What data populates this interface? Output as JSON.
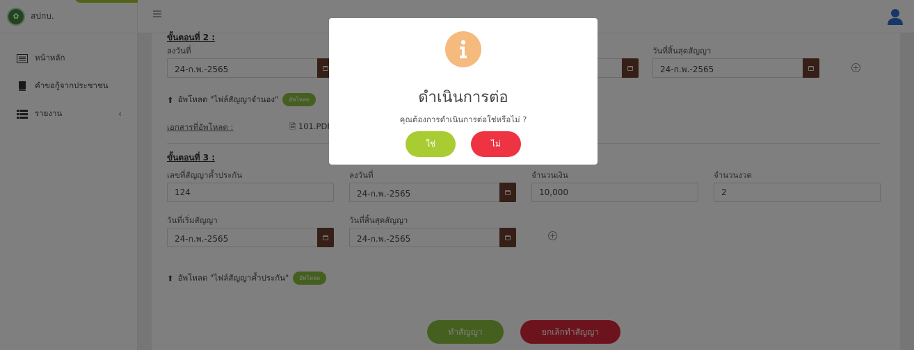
{
  "app": {
    "brand": "สปกบ."
  },
  "sidebar": {
    "items": [
      {
        "label": "หน้าหลัก",
        "icon": "list-icon"
      },
      {
        "label": "คำขอกู้จากประชาชน",
        "icon": "book-icon"
      },
      {
        "label": "รายงาน",
        "icon": "report-list-icon"
      }
    ]
  },
  "step2": {
    "heading": "ขั้นตอนที่ 2 :",
    "sign_date_label": "ลงวันที่",
    "sign_date_value": "24-ก.พ.-2565",
    "end_date_label": "วันที่สิ้นสุดสัญญา",
    "end_date_value": "24-ก.พ.-2565",
    "upload_label": "อัพโหลด \"ไฟล์สัญญาจำนอง\"",
    "upload_button": "อัพโหลด",
    "uploaded_docs_label": "เอกสารที่อัพโหลด :",
    "uploaded_file": "101.PDF"
  },
  "step3": {
    "heading": "ขั้นตอนที่ 3 :",
    "guarantee_no_label": "เลขที่สัญญาค้ำประกัน",
    "guarantee_no_value": "124",
    "sign_date_label": "ลงวันที่",
    "sign_date_value": "24-ก.พ.-2565",
    "amount_label": "จำนวนเงิน",
    "amount_value": "10,000",
    "installments_label": "จำนวนงวด",
    "installments_value": "2",
    "start_date_label": "วันที่เริ่มสัญญา",
    "start_date_value": "24-ก.พ.-2565",
    "end_date_label": "วันที่สิ้นสุดสัญญา",
    "end_date_value": "24-ก.พ.-2565",
    "upload_label": "อัพโหลด \"ไฟล์สัญญาค้ำประกัน\"",
    "upload_button": "อัพโหลด"
  },
  "actions": {
    "make_contract": "ทำสัญญา",
    "cancel_contract": "ยกเลิกทำสัญญา"
  },
  "modal": {
    "icon": "info-icon",
    "title": "ดำเนินการต่อ",
    "message": "คุณต้องการดำเนินการต่อใช่หรือไม่ ?",
    "confirm_label": "ใช่",
    "cancel_label": "ไม่"
  },
  "colors": {
    "accent_green": "#a3c735",
    "confirm_green": "#a8cc32",
    "danger_red": "#ee3343",
    "calendar_brown": "#6b3f2e",
    "info_orange": "#f5ba7e"
  }
}
